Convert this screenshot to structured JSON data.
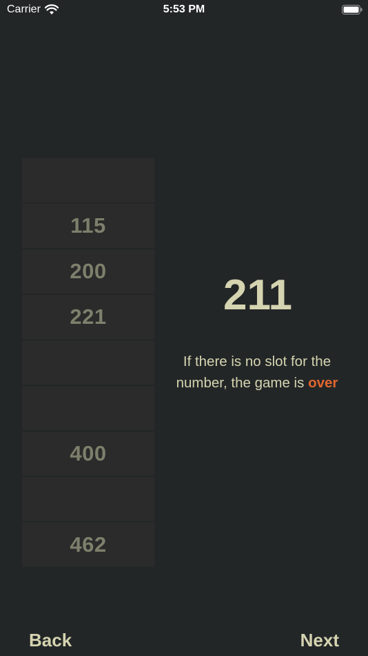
{
  "status_bar": {
    "carrier": "Carrier",
    "time": "5:53 PM"
  },
  "slots": [
    "",
    "115",
    "200",
    "221",
    "",
    "",
    "400",
    "",
    "462"
  ],
  "current_number": "211",
  "rule": {
    "line1": "If there is no slot for the",
    "line2_prefix": "number, the game is ",
    "highlight": "over",
    "highlight_color": "#e2662f"
  },
  "nav": {
    "back_label": "Back",
    "next_label": "Next"
  },
  "colors": {
    "background": "#232627",
    "slot": "#2a2b2a",
    "slot_text": "#7e7f6c",
    "text": "#d5d4b0"
  }
}
